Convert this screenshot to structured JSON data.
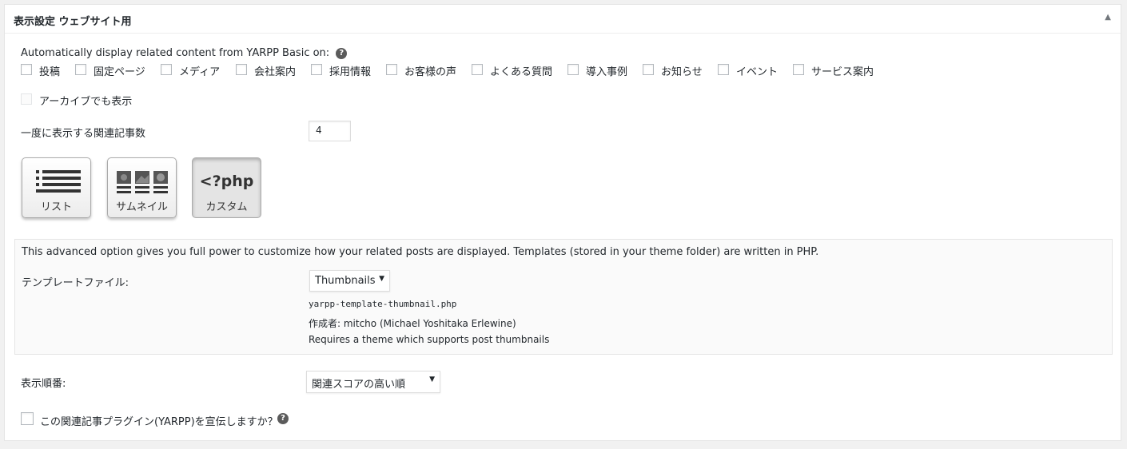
{
  "panel": {
    "title": "表示設定 ウェブサイト用"
  },
  "auto_display": {
    "label": "Automatically display related content from YARPP Basic on:",
    "help_icon": "?",
    "post_types": [
      "投稿",
      "固定ページ",
      "メディア",
      "会社案内",
      "採用情報",
      "お客様の声",
      "よくある質問",
      "導入事例",
      "お知らせ",
      "イベント",
      "サービス案内"
    ]
  },
  "archive": {
    "label": "アーカイブでも表示"
  },
  "limit": {
    "label": "一度に表示する関連記事数",
    "value": "4"
  },
  "templates": {
    "buttons": [
      {
        "label": "リスト",
        "icon": "list-icon"
      },
      {
        "label": "サムネイル",
        "icon": "thumbnails-icon"
      },
      {
        "label": "カスタム",
        "icon_text": "<?php",
        "selected": true
      }
    ]
  },
  "custom": {
    "description": "This advanced option gives you full power to customize how your related posts are displayed. Templates (stored in your theme folder) are written in PHP.",
    "file_label": "テンプレートファイル:",
    "file_value": "Thumbnails",
    "file_name": "yarpp-template-thumbnail.php",
    "author": "作成者: mitcho (Michael Yoshitaka Erlewine)",
    "requirement": "Requires a theme which supports post thumbnails"
  },
  "order": {
    "label": "表示順番:",
    "value": "関連スコアの高い順"
  },
  "promote": {
    "label": "この関連記事プラグイン(YARPP)を宣伝しますか？",
    "help_icon": "?"
  }
}
